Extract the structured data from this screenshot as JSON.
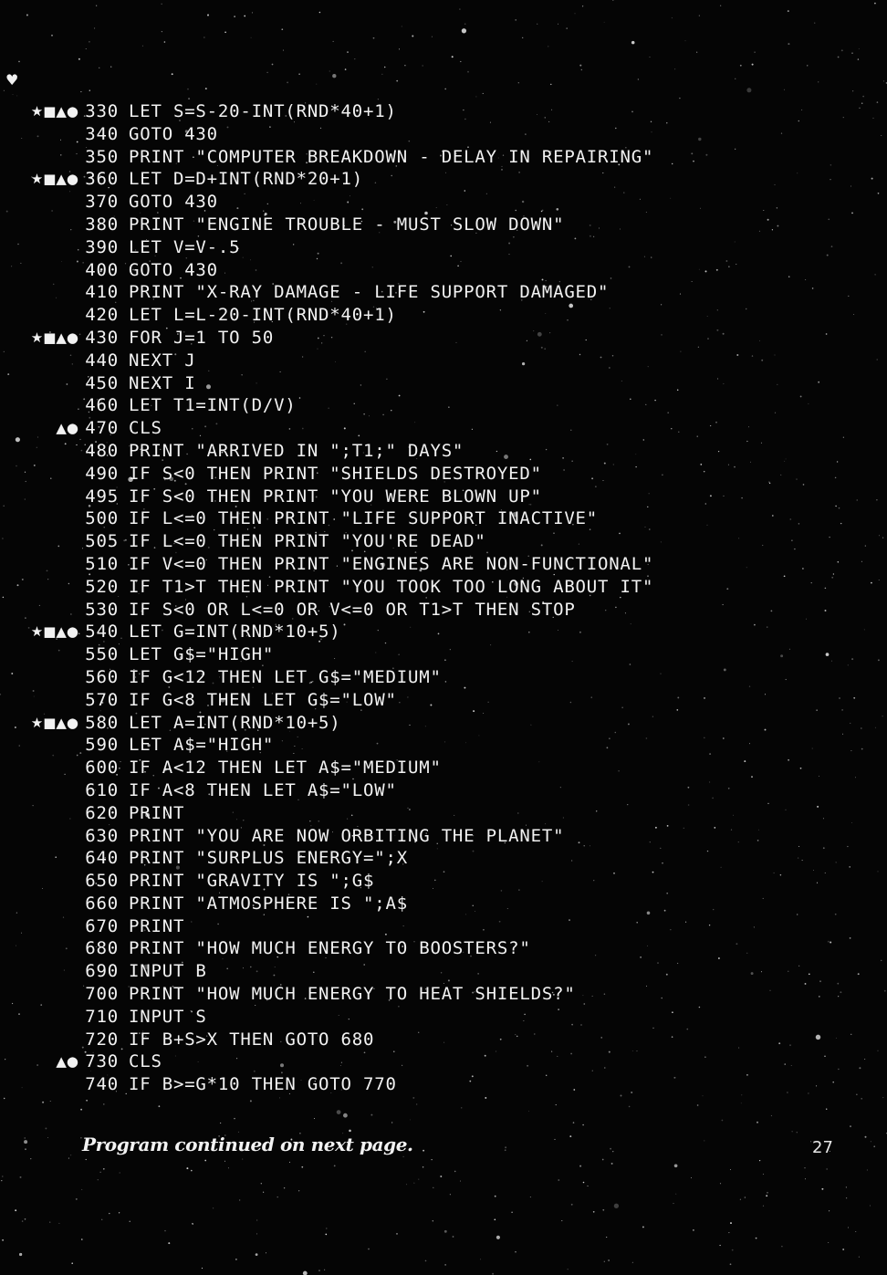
{
  "listing": [
    {
      "marks": "★■▲●",
      "num": "330",
      "code": "LET S=S-20-INT(RND*40+1)"
    },
    {
      "marks": "",
      "num": "340",
      "code": "GOTO 430"
    },
    {
      "marks": "",
      "num": "350",
      "code": "PRINT \"COMPUTER BREAKDOWN - DELAY IN REPAIRING\""
    },
    {
      "marks": "★■▲●",
      "num": "360",
      "code": "LET D=D+INT(RND*20+1)"
    },
    {
      "marks": "",
      "num": "370",
      "code": "GOTO 430"
    },
    {
      "marks": "",
      "num": "380",
      "code": "PRINT \"ENGINE TROUBLE - MUST SLOW DOWN\""
    },
    {
      "marks": "",
      "num": "390",
      "code": "LET V=V-.5"
    },
    {
      "marks": "",
      "num": "400",
      "code": "GOTO 430"
    },
    {
      "marks": "",
      "num": "410",
      "code": "PRINT \"X-RAY DAMAGE - LIFE SUPPORT DAMAGED\""
    },
    {
      "marks": "",
      "num": "420",
      "code": "LET L=L-20-INT(RND*40+1)"
    },
    {
      "marks": "★■▲●",
      "num": "430",
      "code": "FOR J=1 TO 50"
    },
    {
      "marks": "",
      "num": "440",
      "code": "NEXT J"
    },
    {
      "marks": "",
      "num": "450",
      "code": "NEXT I"
    },
    {
      "marks": "",
      "num": "460",
      "code": "LET T1=INT(D/V)"
    },
    {
      "marks": "▲●",
      "num": "470",
      "code": "CLS"
    },
    {
      "marks": "",
      "num": "480",
      "code": "PRINT \"ARRIVED IN \";T1;\" DAYS\""
    },
    {
      "marks": "",
      "num": "490",
      "code": "IF S<0 THEN PRINT \"SHIELDS DESTROYED\""
    },
    {
      "marks": "",
      "num": "495",
      "code": "IF S<0 THEN PRINT \"YOU WERE BLOWN UP\""
    },
    {
      "marks": "",
      "num": "500",
      "code": "IF L<=0 THEN PRINT \"LIFE SUPPORT INACTIVE\""
    },
    {
      "marks": "",
      "num": "505",
      "code": "IF L<=0 THEN PRINT \"YOU'RE DEAD\""
    },
    {
      "marks": "",
      "num": "510",
      "code": "IF V<=0 THEN PRINT \"ENGINES ARE NON-FUNCTIONAL\""
    },
    {
      "marks": "",
      "num": "520",
      "code": "IF T1>T THEN PRINT \"YOU TOOK TOO LONG ABOUT IT\""
    },
    {
      "marks": "",
      "num": "530",
      "code": "IF S<0 OR L<=0 OR V<=0 OR T1>T THEN STOP"
    },
    {
      "marks": "★■▲●",
      "num": "540",
      "code": "LET G=INT(RND*10+5)"
    },
    {
      "marks": "",
      "num": "550",
      "code": "LET G$=\"HIGH\""
    },
    {
      "marks": "",
      "num": "560",
      "code": "IF G<12 THEN LET G$=\"MEDIUM\""
    },
    {
      "marks": "",
      "num": "570",
      "code": "IF G<8 THEN LET G$=\"LOW\""
    },
    {
      "marks": "★■▲●",
      "num": "580",
      "code": "LET A=INT(RND*10+5)"
    },
    {
      "marks": "",
      "num": "590",
      "code": "LET A$=\"HIGH\""
    },
    {
      "marks": "",
      "num": "600",
      "code": "IF A<12 THEN LET A$=\"MEDIUM\""
    },
    {
      "marks": "",
      "num": "610",
      "code": "IF A<8 THEN LET A$=\"LOW\""
    },
    {
      "marks": "",
      "num": "620",
      "code": "PRINT"
    },
    {
      "marks": "",
      "num": "630",
      "code": "PRINT \"YOU ARE NOW ORBITING THE PLANET\""
    },
    {
      "marks": "",
      "num": "640",
      "code": "PRINT \"SURPLUS ENERGY=\";X"
    },
    {
      "marks": "",
      "num": "650",
      "code": "PRINT \"GRAVITY IS \";G$"
    },
    {
      "marks": "",
      "num": "660",
      "code": "PRINT \"ATMOSPHERE IS \";A$"
    },
    {
      "marks": "",
      "num": "670",
      "code": "PRINT"
    },
    {
      "marks": "",
      "num": "680",
      "code": "PRINT \"HOW MUCH ENERGY TO BOOSTERS?\""
    },
    {
      "marks": "",
      "num": "690",
      "code": "INPUT B"
    },
    {
      "marks": "",
      "num": "700",
      "code": "PRINT \"HOW MUCH ENERGY TO HEAT SHIELDS?\""
    },
    {
      "marks": "",
      "num": "710",
      "code": "INPUT S"
    },
    {
      "marks": "",
      "num": "720",
      "code": "IF B+S>X THEN GOTO 680"
    },
    {
      "marks": "▲●",
      "num": "730",
      "code": "CLS"
    },
    {
      "marks": "",
      "num": "740",
      "code": "IF B>=G*10 THEN GOTO 770"
    }
  ],
  "footer": {
    "continued_note": "Program continued on next page.",
    "page_number": "27"
  },
  "decoration": {
    "heart_glyph": "♥"
  },
  "colors": {
    "background": "#050505",
    "text": "#f2f2f2"
  }
}
